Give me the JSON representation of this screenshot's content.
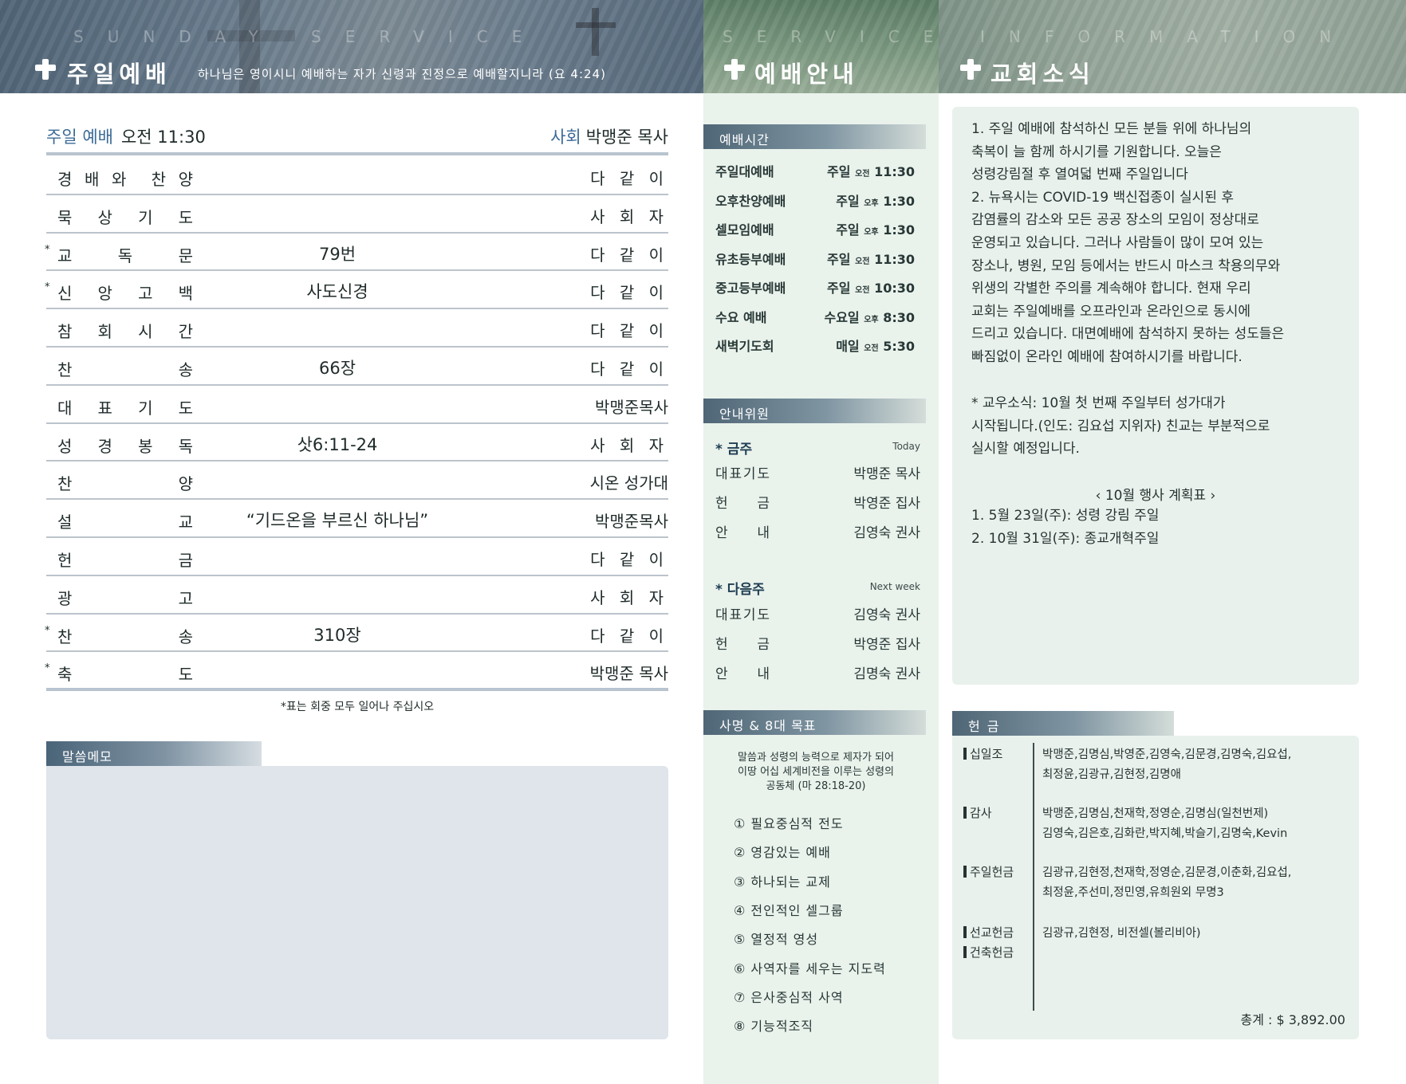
{
  "header": {
    "col1_en": "SUNDAY SERVICE",
    "col1_title": "주일예배",
    "col1_verse": "하나님은 영이시니 예배하는 자가 신령과 진정으로 예배할지니라 (요 4:24)",
    "col2_en": "SERVICE",
    "col2_title": "예배안내",
    "col3_en": "INFORMATION",
    "col3_title": "교회소식"
  },
  "service": {
    "label": "주일 예배",
    "time": "오전 11:30",
    "leader_label": "사회",
    "leader": "박맹준 목사",
    "items": [
      {
        "star": "",
        "label": [
          "경",
          "배",
          "와",
          " ",
          "찬",
          "양"
        ],
        "center": "",
        "right": "다 같 이"
      },
      {
        "star": "",
        "label": [
          "묵",
          "상",
          "기",
          "도"
        ],
        "center": "",
        "right": "사 회 자"
      },
      {
        "star": "*",
        "label": [
          "교",
          "독",
          "문"
        ],
        "center": "79번",
        "right": "다 같 이"
      },
      {
        "star": "*",
        "label": [
          "신",
          "앙",
          "고",
          "백"
        ],
        "center": "사도신경",
        "right": "다 같 이"
      },
      {
        "star": "",
        "label": [
          "참",
          "회",
          "시",
          "간"
        ],
        "center": "",
        "right": "다 같 이"
      },
      {
        "star": "",
        "label": [
          "찬",
          "송"
        ],
        "center": "66장",
        "right": "다 같 이"
      },
      {
        "star": "",
        "label": [
          "대",
          "표",
          "기",
          "도"
        ],
        "center": "",
        "right": "박맹준목사"
      },
      {
        "star": "",
        "label": [
          "성",
          "경",
          "봉",
          "독"
        ],
        "center": "삿6:11-24",
        "right": "사 회 자"
      },
      {
        "star": "",
        "label": [
          "찬",
          "양"
        ],
        "center": "",
        "right": "시온 성가대"
      },
      {
        "star": "",
        "label": [
          "설",
          "교"
        ],
        "center": "“기드온을 부르신 하나님”",
        "right": "박맹준목사"
      },
      {
        "star": "",
        "label": [
          "헌",
          "금"
        ],
        "center": "",
        "right": "다 같 이"
      },
      {
        "star": "",
        "label": [
          "광",
          "고"
        ],
        "center": "",
        "right": "사 회 자"
      },
      {
        "star": "*",
        "label": [
          "찬",
          "송"
        ],
        "center": "310장",
        "right": "다 같 이"
      },
      {
        "star": "*",
        "label": [
          "축",
          "도"
        ],
        "center": "",
        "right": "박맹준 목사"
      }
    ],
    "note": "*표는 회중 모두 일어나 주십시오"
  },
  "memo": {
    "title": "말씀메모"
  },
  "times": {
    "title": "예배시간",
    "rows": [
      {
        "name": "주일대예배",
        "day": "주일",
        "ampm": "오전",
        "time": "11:30"
      },
      {
        "name": "오후찬양예배",
        "day": "주일",
        "ampm": "오후",
        "time": "1:30"
      },
      {
        "name": "셀모임예배",
        "day": "주일",
        "ampm": "오후",
        "time": "1:30"
      },
      {
        "name": "유초등부예배",
        "day": "주일",
        "ampm": "오전",
        "time": "11:30"
      },
      {
        "name": "중고등부예배",
        "day": "주일",
        "ampm": "오전",
        "time": "10:30"
      },
      {
        "name": "수요 예배",
        "day": "수요일",
        "ampm": "오후",
        "time": "8:30"
      },
      {
        "name": "새벽기도회",
        "day": "매일",
        "ampm": "오전",
        "time": "5:30"
      }
    ]
  },
  "ushers": {
    "title": "안내위원",
    "this_week": {
      "label": "* 금주",
      "en": "Today",
      "rows": [
        {
          "role": [
            "대",
            "표",
            "기",
            "도"
          ],
          "name": "박맹준 목사"
        },
        {
          "role": [
            "헌",
            "금"
          ],
          "name": "박영준 집사"
        },
        {
          "role": [
            "안",
            "내"
          ],
          "name": "김영숙 권사"
        }
      ]
    },
    "next_week": {
      "label": "* 다음주",
      "en": "Next week",
      "rows": [
        {
          "role": [
            "대",
            "표",
            "기",
            "도"
          ],
          "name": "김영숙 권사"
        },
        {
          "role": [
            "헌",
            "금"
          ],
          "name": "박영준 집사"
        },
        {
          "role": [
            "안",
            "내"
          ],
          "name": "김명숙 권사"
        }
      ]
    }
  },
  "mission": {
    "title": "사명 & 8대 목표",
    "statement": [
      "말씀과 성령의 능력으로 제자가 되어",
      "이땅 어십 세계비전을 이루는 성령의",
      "공동체 (마 28:18-20)"
    ],
    "goals": [
      "① 필요중심적 전도",
      "② 영감있는 예배",
      "③ 하나되는 교제",
      "④ 전인적인 셀그룹",
      "⑤ 열정적 영성",
      "⑥ 사역자를 세우는 지도력",
      "⑦ 은사중심적 사역",
      "⑧ 기능적조직"
    ]
  },
  "news": {
    "lines_a": [
      "1. 주일 예배에 참석하신 모든 분들 위에 하나님의",
      "축복이 늘 함께 하시기를 기원합니다. 오늘은",
      "성령강림절 후 열여덟 번째 주일입니다",
      "2. 뉴욕시는 COVID-19 백신접종이 실시된 후",
      "감염률의 감소와 모든 공공 장소의 모임이 정상대로",
      "운영되고 있습니다. 그러나 사람들이 많이 모여 있는",
      "장소나, 병원, 모임 등에서는 반드시 마스크 착용의무와",
      "위생의 각별한 주의를 계속해야 합니다. 현재 우리",
      "교회는 주일예배를 오프라인과 온라인으로 동시에",
      "드리고 있습니다. 대면예배에 참석하지 못하는 성도들은",
      "빠짐없이 온라인 예배에 참여하시기를 바랍니다."
    ],
    "lines_b": [
      "* 교우소식: 10월 첫 번째 주일부터 성가대가",
      "시작됩니다.(인도: 김요섭 지위자) 친교는 부분적으로",
      "실시할 예정입니다."
    ],
    "plan_title": "‹  10월 행사 계획표  ›",
    "plan_items": [
      "1. 5월 23일(주): 성령 강림 주일",
      "2. 10월 31일(주): 종교개혁주일"
    ]
  },
  "offering": {
    "title": "헌 금",
    "groups": [
      {
        "label": "십일조",
        "names": [
          "박맹준,김명심,박영준,김영숙,김문경,김명숙,김요섭,",
          "최정윤,김광규,김현정,김명애"
        ]
      },
      {
        "label": "감사",
        "names": [
          "박맹준,김명심,천재학,정영순,김명심(일천번제)",
          "김영숙,김은호,김화란,박지혜,박슬기,김명숙,Kevin"
        ]
      },
      {
        "label": "주일헌금",
        "names": [
          "김광규,김현정,천재학,정영순,김문경,이춘화,김요섭,",
          "최정윤,주선미,정민영,유희원외 무명3"
        ]
      },
      {
        "label": "선교헌금",
        "names": [
          "김광규,김현정, 비전셀(볼리비아)"
        ]
      },
      {
        "label": "건축헌금",
        "names": []
      }
    ],
    "total": "총계 : $ 3,892.00"
  }
}
